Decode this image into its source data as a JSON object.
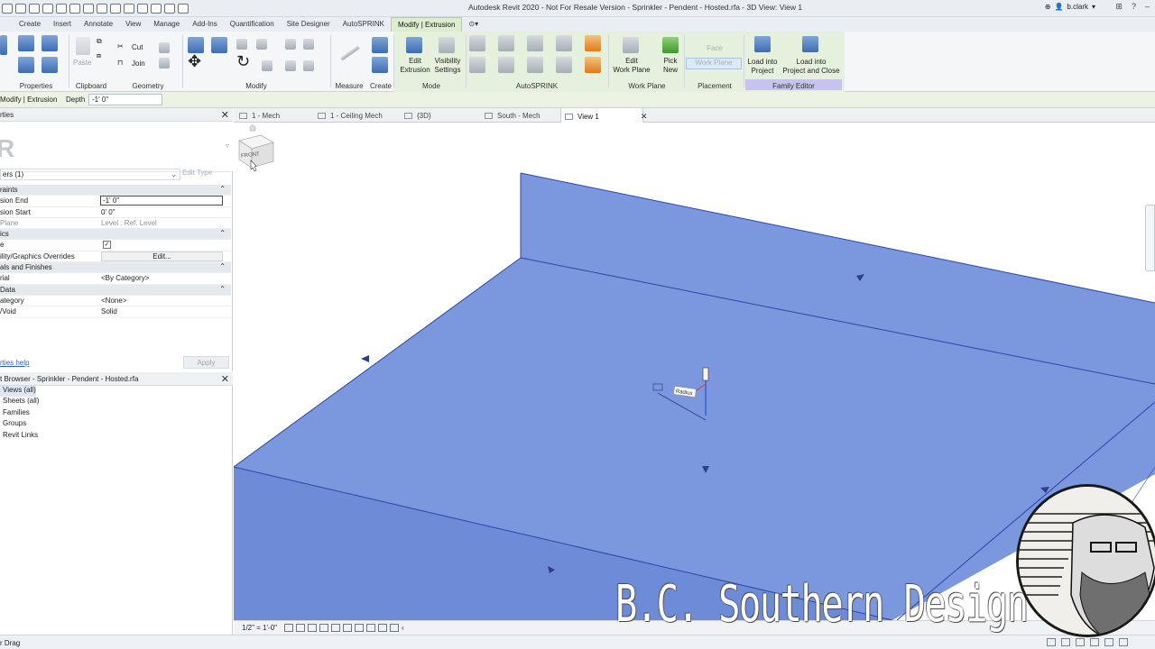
{
  "titlebar": {
    "title": "Autodesk Revit 2020 - Not For Resale Version - Sprinkler - Pendent - Hosted.rfa - 3D View: View 1",
    "username": "b.clark"
  },
  "ribbon_tabs": [
    "Create",
    "Insert",
    "Annotate",
    "View",
    "Manage",
    "Add-Ins",
    "Quantification",
    "Site Designer",
    "AutoSPRINK",
    "Modify | Extrusion"
  ],
  "ribbon": {
    "groups": {
      "properties": "Properties",
      "clipboard": "Clipboard",
      "geometry": "Geometry",
      "modify": "Modify",
      "measure": "Measure",
      "create": "Create",
      "mode": "Mode",
      "autosprink": "AutoSPRINK",
      "work_plane": "Work Plane",
      "placement": "Placement",
      "family_editor": "Family Editor"
    },
    "buttons": {
      "paste": "Paste",
      "cut": "Cut",
      "join": "Join",
      "edit_extrusion_1": "Edit",
      "edit_extrusion_2": "Extrusion",
      "visibility_1": "Visibility",
      "visibility_2": "Settings",
      "edit_work_plane_1": "Edit",
      "edit_work_plane_2": "Work Plane",
      "pick_new_1": "Pick",
      "pick_new_2": "New",
      "face": "Face",
      "work_plane": "Work Plane",
      "load_into_project_1": "Load into",
      "load_into_project_2": "Project",
      "load_close_1": "Load into",
      "load_close_2": "Project and Close"
    }
  },
  "optionsbar": {
    "context": "Modify | Extrusion",
    "depth_label": "Depth",
    "depth_value": "-1' 0\""
  },
  "properties": {
    "title": "rties",
    "selector": "ers (1)",
    "edit_type": "Edit Type",
    "rows": [
      {
        "type": "cat",
        "label": "raints"
      },
      {
        "type": "input",
        "label": "sion End",
        "value": "-1' 0\""
      },
      {
        "type": "text",
        "label": "sion Start",
        "value": "0' 0\""
      },
      {
        "type": "disabled",
        "label": "Plane",
        "value": "Level : Ref. Level"
      },
      {
        "type": "cat",
        "label": "ics"
      },
      {
        "type": "check",
        "label": "e",
        "value": "✓"
      },
      {
        "type": "button",
        "label": "ility/Graphics Overrides",
        "value": "Edit..."
      },
      {
        "type": "cat",
        "label": "als and Finishes"
      },
      {
        "type": "text",
        "label": "rial",
        "value": "<By Category>"
      },
      {
        "type": "cat",
        "label": "Data"
      },
      {
        "type": "text",
        "label": "ategory",
        "value": "<None>"
      },
      {
        "type": "text",
        "label": "/Void",
        "value": "Solid"
      }
    ],
    "help_link": "rties help",
    "apply": "Apply"
  },
  "browser": {
    "title": "t Browser - Sprinkler - Pendent - Hosted.rfa",
    "items": [
      "Views (all)",
      "Sheets (all)",
      "Families",
      "Groups",
      "Revit Links"
    ]
  },
  "view_tabs": [
    {
      "label": "1 - Mech"
    },
    {
      "label": "1 - Ceiling Mech"
    },
    {
      "label": "{3D}"
    },
    {
      "label": "South - Mech"
    },
    {
      "label": "View 1"
    }
  ],
  "viewport": {
    "radius_tag": "Radius",
    "viewcube_label": "FRONT"
  },
  "viewctl": {
    "scale": "1/2\" = 1'-0\""
  },
  "status": {
    "text": "r Drag"
  },
  "watermark": "B.C. Southern Design"
}
